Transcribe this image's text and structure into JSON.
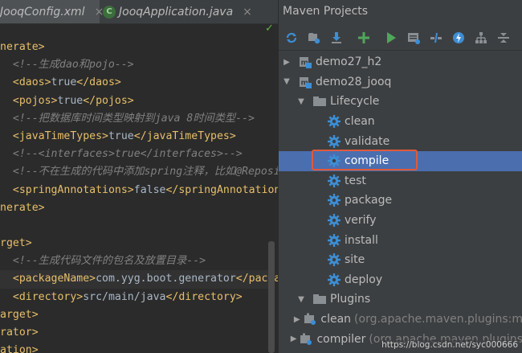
{
  "editor": {
    "tabs": [
      {
        "label": "JooqConfig.xml",
        "icon": "xml-file-icon",
        "close": "×"
      },
      {
        "label": "JooqApplication.java",
        "icon": "spring-boot-class-icon",
        "close": "×"
      }
    ],
    "check": "✓",
    "lines": [
      [
        {
          "c": "tag",
          "t": "nerate>"
        }
      ],
      [
        {
          "c": "cmt",
          "t": "  <!--生成dao和pojo-->"
        }
      ],
      [
        {
          "c": "txt",
          "t": "  "
        },
        {
          "c": "tag",
          "t": "<daos>"
        },
        {
          "c": "txt",
          "t": "true"
        },
        {
          "c": "tag",
          "t": "</daos>"
        }
      ],
      [
        {
          "c": "txt",
          "t": "  "
        },
        {
          "c": "tag",
          "t": "<pojos>"
        },
        {
          "c": "txt",
          "t": "true"
        },
        {
          "c": "tag",
          "t": "</pojos>"
        }
      ],
      [
        {
          "c": "cmt",
          "t": "  <!--把数据库时间类型映射到java 8时间类型-->"
        }
      ],
      [
        {
          "c": "txt",
          "t": "  "
        },
        {
          "c": "tag",
          "t": "<javaTimeTypes>"
        },
        {
          "c": "txt",
          "t": "true"
        },
        {
          "c": "tag",
          "t": "</javaTimeTypes>"
        }
      ],
      [
        {
          "c": "cmt",
          "t": "  <!--<interfaces>true</interfaces>-->"
        }
      ],
      [
        {
          "c": "cmt",
          "t": "  <!--不在生成的代码中添加spring注释，比如@Repository"
        }
      ],
      [
        {
          "c": "txt",
          "t": "  "
        },
        {
          "c": "tag",
          "t": "<springAnnotations>"
        },
        {
          "c": "txt",
          "t": "false"
        },
        {
          "c": "tag",
          "t": "</springAnnotations>"
        }
      ],
      [
        {
          "c": "tag",
          "t": "nerate>"
        }
      ],
      [
        {
          "c": "txt",
          "t": ""
        }
      ],
      [
        {
          "c": "tag",
          "t": "rget>"
        }
      ],
      [
        {
          "c": "cmt",
          "t": "  <!--生成代码文件的包名及放置目录-->"
        }
      ],
      [
        {
          "c": "txt",
          "t": "  "
        },
        {
          "c": "tag",
          "t": "<packageName>"
        },
        {
          "c": "txt",
          "t": "com.yyg.boot.generator"
        },
        {
          "c": "tag",
          "t": "</packageN"
        }
      ],
      [
        {
          "c": "txt",
          "t": "  "
        },
        {
          "c": "tag",
          "t": "<directory>"
        },
        {
          "c": "txt",
          "t": "src/main/java"
        },
        {
          "c": "tag",
          "t": "</directory>"
        }
      ],
      [
        {
          "c": "tag",
          "t": "arget>"
        }
      ],
      [
        {
          "c": "tag",
          "t": "rator>"
        }
      ],
      [
        {
          "c": "tag",
          "t": "ation>"
        }
      ]
    ]
  },
  "maven": {
    "title": "Maven Projects",
    "toolbar": [
      {
        "name": "reimport-icon"
      },
      {
        "name": "generate-sources-icon"
      },
      {
        "name": "download-icon"
      },
      {
        "name": "add-project-icon"
      },
      {
        "name": "run-icon"
      },
      {
        "name": "execute-goal-icon"
      },
      {
        "name": "toggle-offline-icon"
      },
      {
        "name": "skip-tests-icon"
      },
      {
        "name": "show-dependencies-icon"
      },
      {
        "name": "collapse-all-icon"
      }
    ],
    "tree": [
      {
        "label": "demo27_h2",
        "level": 0,
        "arrow": "▶",
        "icon": "maven-module-icon"
      },
      {
        "label": "demo28_jooq",
        "level": 0,
        "arrow": "▼",
        "icon": "maven-module-icon"
      },
      {
        "label": "Lifecycle",
        "level": 1,
        "arrow": "▼",
        "icon": "folder-icon"
      },
      {
        "label": "clean",
        "level": 2,
        "icon": "gear-icon"
      },
      {
        "label": "validate",
        "level": 2,
        "icon": "gear-icon"
      },
      {
        "label": "compile",
        "level": 2,
        "icon": "gear-icon",
        "selected": true
      },
      {
        "label": "test",
        "level": 2,
        "icon": "gear-icon"
      },
      {
        "label": "package",
        "level": 2,
        "icon": "gear-icon"
      },
      {
        "label": "verify",
        "level": 2,
        "icon": "gear-icon"
      },
      {
        "label": "install",
        "level": 2,
        "icon": "gear-icon"
      },
      {
        "label": "site",
        "level": 2,
        "icon": "gear-icon"
      },
      {
        "label": "deploy",
        "level": 2,
        "icon": "gear-icon"
      },
      {
        "label": "Plugins",
        "level": 1,
        "arrow": "▼",
        "icon": "folder-icon"
      },
      {
        "label": "clean",
        "suffix": "(org.apache.maven.plugins:m",
        "level": 2,
        "arrow": "▶",
        "icon": "plugin-icon"
      },
      {
        "label": "compiler",
        "suffix": "(org.apache.maven.plugins",
        "level": 2,
        "arrow": "▶",
        "icon": "plugin-icon"
      }
    ],
    "watermark": "https://blog.csdn.net/syc000666"
  },
  "colors": {
    "accent_selection": "#4b6eaf",
    "focus_outline": "#e05a3a",
    "gear": "#3d8ed4",
    "run": "#4fa75a"
  }
}
